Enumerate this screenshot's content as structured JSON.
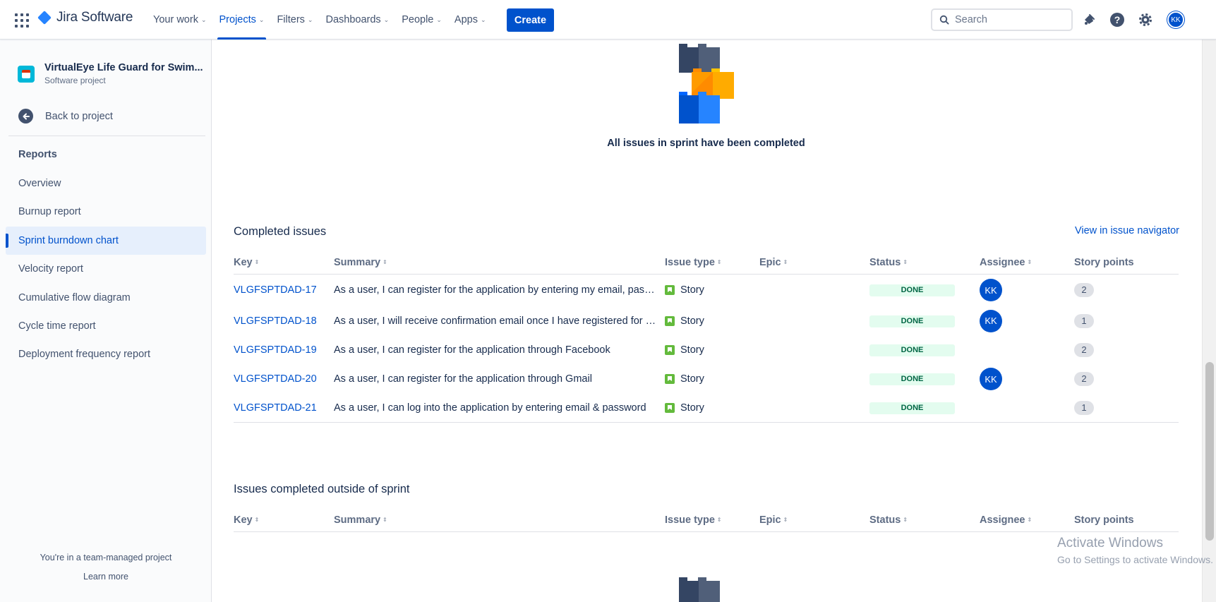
{
  "topnav": {
    "brand": "Jira Software",
    "items": [
      {
        "label": "Your work",
        "active": false
      },
      {
        "label": "Projects",
        "active": true
      },
      {
        "label": "Filters",
        "active": false
      },
      {
        "label": "Dashboards",
        "active": false
      },
      {
        "label": "People",
        "active": false
      },
      {
        "label": "Apps",
        "active": false
      }
    ],
    "create_label": "Create",
    "search_placeholder": "Search",
    "user_initials": "KK",
    "icons": [
      "app-switcher-icon",
      "notifications-icon",
      "help-icon",
      "settings-icon"
    ]
  },
  "sidebar": {
    "project_name": "VirtualEye Life Guard for Swim...",
    "project_type": "Software project",
    "back_label": "Back to project",
    "section_heading": "Reports",
    "items": [
      {
        "label": "Overview",
        "active": false
      },
      {
        "label": "Burnup report",
        "active": false
      },
      {
        "label": "Sprint burndown chart",
        "active": true
      },
      {
        "label": "Velocity report",
        "active": false
      },
      {
        "label": "Cumulative flow diagram",
        "active": false
      },
      {
        "label": "Cycle time report",
        "active": false
      },
      {
        "label": "Deployment frequency report",
        "active": false
      }
    ],
    "footer_text": "You're in a team-managed project",
    "footer_link": "Learn more"
  },
  "main": {
    "empty_state_text": "All issues in sprint have been completed",
    "completed_title": "Completed issues",
    "navigator_link": "View in issue navigator",
    "columns": [
      "Key",
      "Summary",
      "Issue type",
      "Epic",
      "Status",
      "Assignee",
      "Story points"
    ],
    "completed_rows": [
      {
        "key": "VLGFSPTDAD-17",
        "summary": "As a user, I can register for the application by entering my email, passw...",
        "type": "Story",
        "epic": "",
        "status": "DONE",
        "assignee": "KK",
        "points": "2"
      },
      {
        "key": "VLGFSPTDAD-18",
        "summary": "As a user, I will receive confirmation email once I have registered for th...",
        "type": "Story",
        "epic": "",
        "status": "DONE",
        "assignee": "KK",
        "points": "1"
      },
      {
        "key": "VLGFSPTDAD-19",
        "summary": "As a user, I can register for the application through Facebook",
        "type": "Story",
        "epic": "",
        "status": "DONE",
        "assignee": "",
        "points": "2"
      },
      {
        "key": "VLGFSPTDAD-20",
        "summary": "As a user, I can register for the application through Gmail",
        "type": "Story",
        "epic": "",
        "status": "DONE",
        "assignee": "KK",
        "points": "2"
      },
      {
        "key": "VLGFSPTDAD-21",
        "summary": "As a user, I can log into the application by entering email & password",
        "type": "Story",
        "epic": "",
        "status": "DONE",
        "assignee": "",
        "points": "1"
      }
    ],
    "outside_title": "Issues completed outside of sprint"
  },
  "overlay": {
    "activate_title": "Activate Windows",
    "activate_sub": "Go to Settings to activate Windows."
  },
  "colors": {
    "brand_blue": "#0052cc",
    "done_bg": "#e3fcef",
    "done_fg": "#006644",
    "story_green": "#63ba3c"
  }
}
